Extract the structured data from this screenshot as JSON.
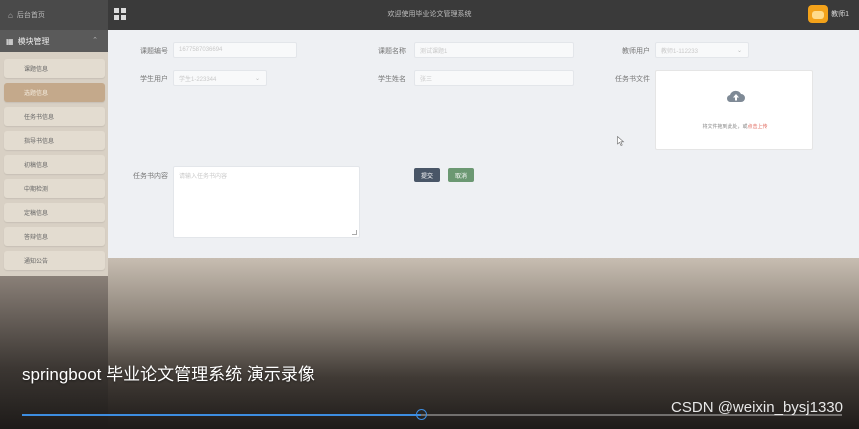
{
  "topbar": {
    "home_label": "后台首页",
    "welcome_text": "欢迎使用毕业论文管理系统",
    "username": "教师1"
  },
  "sidebar": {
    "module_title": "模块管理",
    "items": [
      {
        "label": "课题信息"
      },
      {
        "label": "选题信息",
        "active": true
      },
      {
        "label": "任务书信息"
      },
      {
        "label": "指导书信息"
      },
      {
        "label": "初稿信息"
      },
      {
        "label": "中期检测"
      },
      {
        "label": "定稿信息"
      },
      {
        "label": "答辩信息"
      },
      {
        "label": "通知公告"
      }
    ]
  },
  "form": {
    "topic_no_label": "课题编号",
    "topic_no_value": "1677587036694",
    "topic_name_label": "课题名称",
    "topic_name_value": "测试课题1",
    "teacher_user_label": "教师用户",
    "teacher_user_value": "教师1-112233",
    "student_user_label": "学生用户",
    "student_user_value": "学生1-223344",
    "student_name_label": "学生姓名",
    "student_name_value": "张三",
    "task_file_label": "任务书文件",
    "upload_hint": "将文件拖到此处，或",
    "upload_link": "点击上传",
    "task_content_label": "任务书内容",
    "task_content_placeholder": "请输入任务书内容",
    "submit_label": "提交",
    "cancel_label": "取消"
  },
  "video": {
    "caption": "springboot 毕业论文管理系统 演示录像",
    "watermark": "CSDN @weixin_bysj1330",
    "progress": 0.487
  },
  "colors": {
    "active_item": "#c4a98b",
    "submit_button": "#495667",
    "cancel_button": "#6b9872",
    "progress": "#3d8de0"
  }
}
